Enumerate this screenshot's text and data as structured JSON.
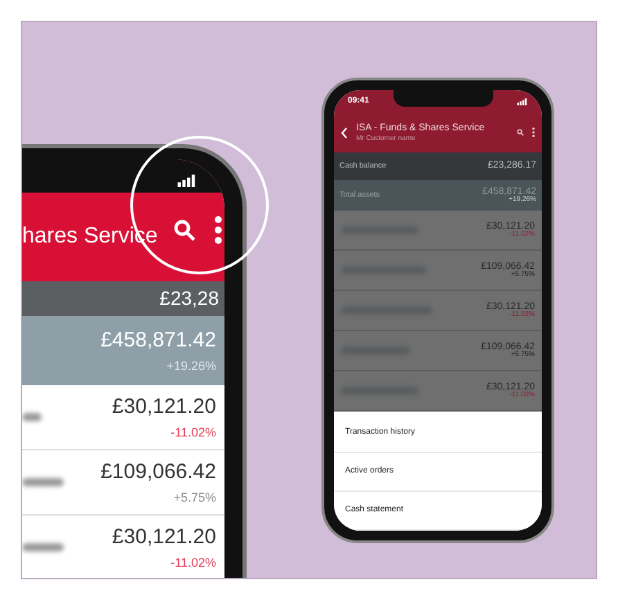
{
  "zoom_view": {
    "title": "hares Service",
    "cash_balance": "£23,28",
    "total_assets": {
      "value": "£458,871.42",
      "change": "+19.26%"
    },
    "holdings": [
      {
        "value": "£30,121.20",
        "change": "-11.02%",
        "negative": true
      },
      {
        "value": "£109,066.42",
        "change": "+5.75%",
        "negative": false
      },
      {
        "value": "£30,121.20",
        "change": "-11.02%",
        "negative": true
      }
    ]
  },
  "phone": {
    "time": "09:41",
    "header": {
      "title": "ISA - Funds & Shares Service",
      "subtitle": "Mr Customer name"
    },
    "cash_balance": {
      "label": "Cash balance",
      "value": "£23,286.17"
    },
    "total_assets": {
      "label": "Total assets",
      "value": "£458,871.42",
      "change": "+19.26%"
    },
    "holdings": [
      {
        "value": "£30,121.20",
        "change": "-11.02%",
        "negative": true
      },
      {
        "value": "£109,066.42",
        "change": "+5.75%",
        "negative": false
      },
      {
        "value": "£30,121.20",
        "change": "-11.02%",
        "negative": true
      },
      {
        "value": "£109,066.42",
        "change": "+5.75%",
        "negative": false
      },
      {
        "value": "£30,121.20",
        "change": "-11.02%",
        "negative": true
      }
    ],
    "menu": [
      "Transaction history",
      "Active orders",
      "Cash statement"
    ]
  }
}
